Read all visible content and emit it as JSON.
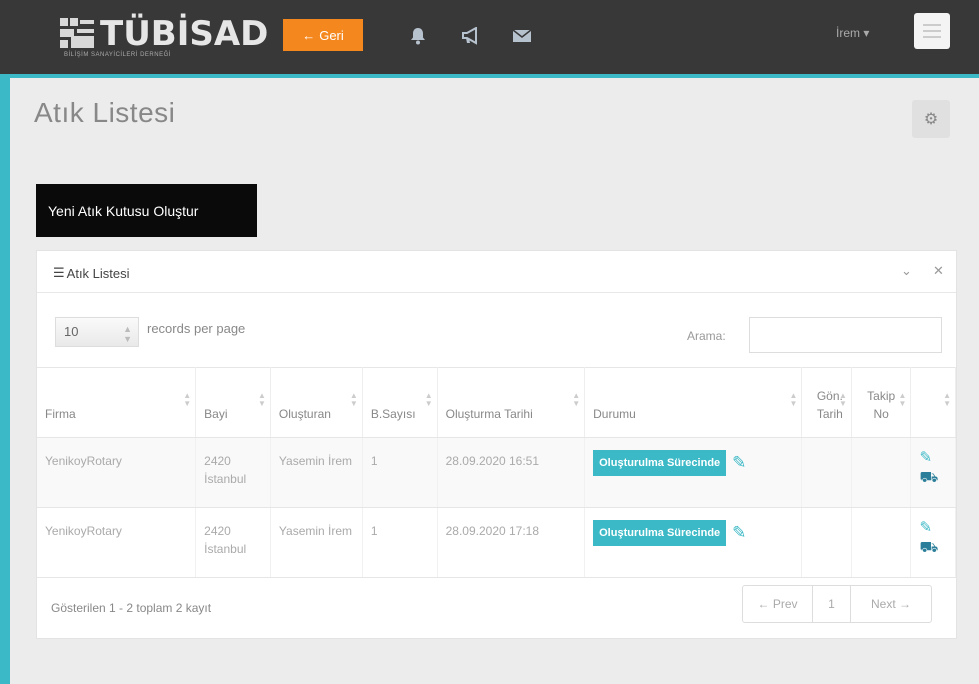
{
  "header": {
    "logo_text": "TÜBİSAD",
    "logo_subtitle": "BİLİŞİM SANAYİCİLERİ DERNEĞİ",
    "back_button": "Geri",
    "user_name": "İrem",
    "icons": [
      "bell-icon",
      "bullhorn-icon",
      "envelope-icon",
      "menu-icon"
    ]
  },
  "page": {
    "title": "Atık Listesi",
    "create_button": "Yeni Atık Kutusu Oluştur"
  },
  "panel": {
    "title": "Atık Listesi",
    "length_value": "10",
    "length_label": "records per page",
    "search_label": "Arama:",
    "search_value": "",
    "columns": [
      "Firma",
      "Bayi",
      "Oluşturan",
      "B.Sayısı",
      "Oluşturma Tarihi",
      "Durumu",
      "Gön. Tarih",
      "Takip No",
      ""
    ],
    "rows": [
      {
        "firma": "YenikoyRotary",
        "bayi": "2420 İstanbul",
        "olusturan": "Yasemin İrem",
        "b_sayisi": "1",
        "tarih": "28.09.2020 16:51",
        "durum": "Oluşturulma Sürecinde",
        "gon_tarih": "",
        "takip_no": ""
      },
      {
        "firma": "YenikoyRotary",
        "bayi": "2420 İstanbul",
        "olusturan": "Yasemin İrem",
        "b_sayisi": "1",
        "tarih": "28.09.2020 17:18",
        "durum": "Oluşturulma Sürecinde",
        "gon_tarih": "",
        "takip_no": ""
      }
    ],
    "info": "Gösterilen 1 - 2 toplam 2 kayıt",
    "pagination": {
      "prev": "← Prev",
      "current": "1",
      "next": "Next →"
    }
  },
  "colors": {
    "accent": "#3cb9c6",
    "topbar": "#383838",
    "back_button": "#f5871f",
    "create_button": "#0a0a0a"
  }
}
